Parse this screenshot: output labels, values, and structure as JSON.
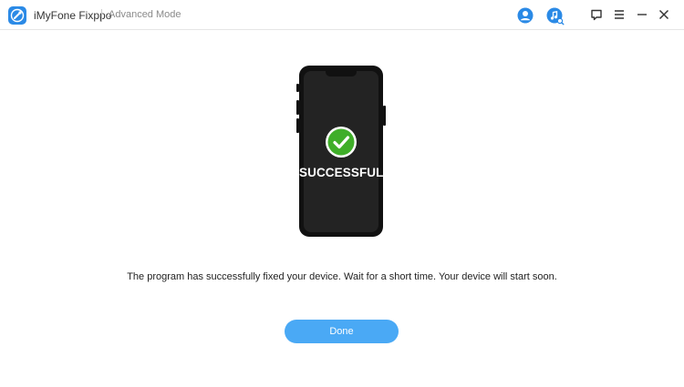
{
  "app": {
    "name": "iMyFone Fixppo",
    "mode": "Advanced Mode",
    "logo_icon": "wrench-icon",
    "accent_color": "#2b8ae6"
  },
  "titlebar": {
    "icons": [
      "account-icon",
      "music-search-icon",
      "feedback-icon",
      "menu-icon",
      "minimize-icon",
      "close-icon"
    ]
  },
  "status": {
    "label": "SUCCESSFUL",
    "icon": "check-circle-icon",
    "color": "#3fae29"
  },
  "message": "The program has successfully fixed your device. Wait for a short time. Your device will start soon.",
  "done_button": {
    "label": "Done",
    "color": "#4aa9f5"
  }
}
